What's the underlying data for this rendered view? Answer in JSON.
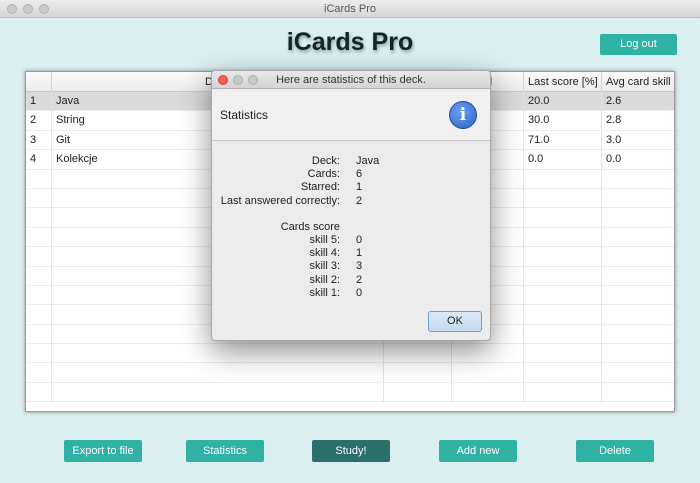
{
  "window": {
    "title": "iCards Pro"
  },
  "header": {
    "app_title": "iCards Pro",
    "logout_label": "Log out"
  },
  "table": {
    "columns": [
      "",
      "Deck",
      "",
      "Starred",
      "Last score [%]",
      "Avg card skill"
    ],
    "rows": [
      {
        "index": "1",
        "deck": "Java",
        "cards": "",
        "starred": "",
        "last_score": "20.0",
        "avg_skill": "2.6"
      },
      {
        "index": "2",
        "deck": "String",
        "cards": "",
        "starred": "",
        "last_score": "30.0",
        "avg_skill": "2.8"
      },
      {
        "index": "3",
        "deck": "Git",
        "cards": "",
        "starred": "",
        "last_score": "71.0",
        "avg_skill": "3.0"
      },
      {
        "index": "4",
        "deck": "Kolekcje",
        "cards": "",
        "starred": "",
        "last_score": "0.0",
        "avg_skill": "0.0"
      }
    ],
    "selected_row": 0
  },
  "dialog": {
    "title": "Here are statistics of this deck.",
    "header": "Statistics",
    "stats": [
      {
        "label": "Deck:",
        "value": "Java"
      },
      {
        "label": "Cards:",
        "value": "6"
      },
      {
        "label": "Starred:",
        "value": "1"
      },
      {
        "label": "Last answered correctly:",
        "value": "2"
      }
    ],
    "score_title": "Cards score",
    "scores": [
      {
        "label": "skill 5:",
        "value": "0"
      },
      {
        "label": "skill 4:",
        "value": "1"
      },
      {
        "label": "skill 3:",
        "value": "3"
      },
      {
        "label": "skill 2:",
        "value": "2"
      },
      {
        "label": "skill 1:",
        "value": "0"
      }
    ],
    "ok_label": "OK"
  },
  "toolbar": {
    "export_label": "Export to file",
    "statistics_label": "Statistics",
    "study_label": "Study!",
    "add_label": "Add new",
    "delete_label": "Delete"
  },
  "colors": {
    "background": "#dceff0",
    "button": "#2fb1a4",
    "button_primary": "#2b6f6a"
  }
}
